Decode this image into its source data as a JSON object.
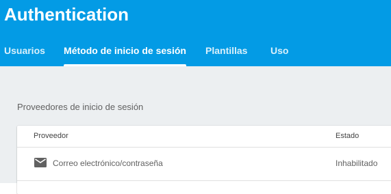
{
  "header": {
    "title": "Authentication"
  },
  "tabs": [
    {
      "label": "Usuarios",
      "active": false
    },
    {
      "label": "Método de inicio de sesión",
      "active": true
    },
    {
      "label": "Plantillas",
      "active": false
    },
    {
      "label": "Uso",
      "active": false
    }
  ],
  "providers": {
    "section_title": "Proveedores de inicio de sesión",
    "columns": {
      "provider": "Proveedor",
      "status": "Estado"
    },
    "rows": [
      {
        "icon": "mail-icon",
        "name": "Correo electrónico/contraseña",
        "status": "Inhabilitado"
      }
    ]
  },
  "colors": {
    "header_bg": "#039be5",
    "content_bg": "#eceff1",
    "card_bg": "#ffffff"
  }
}
